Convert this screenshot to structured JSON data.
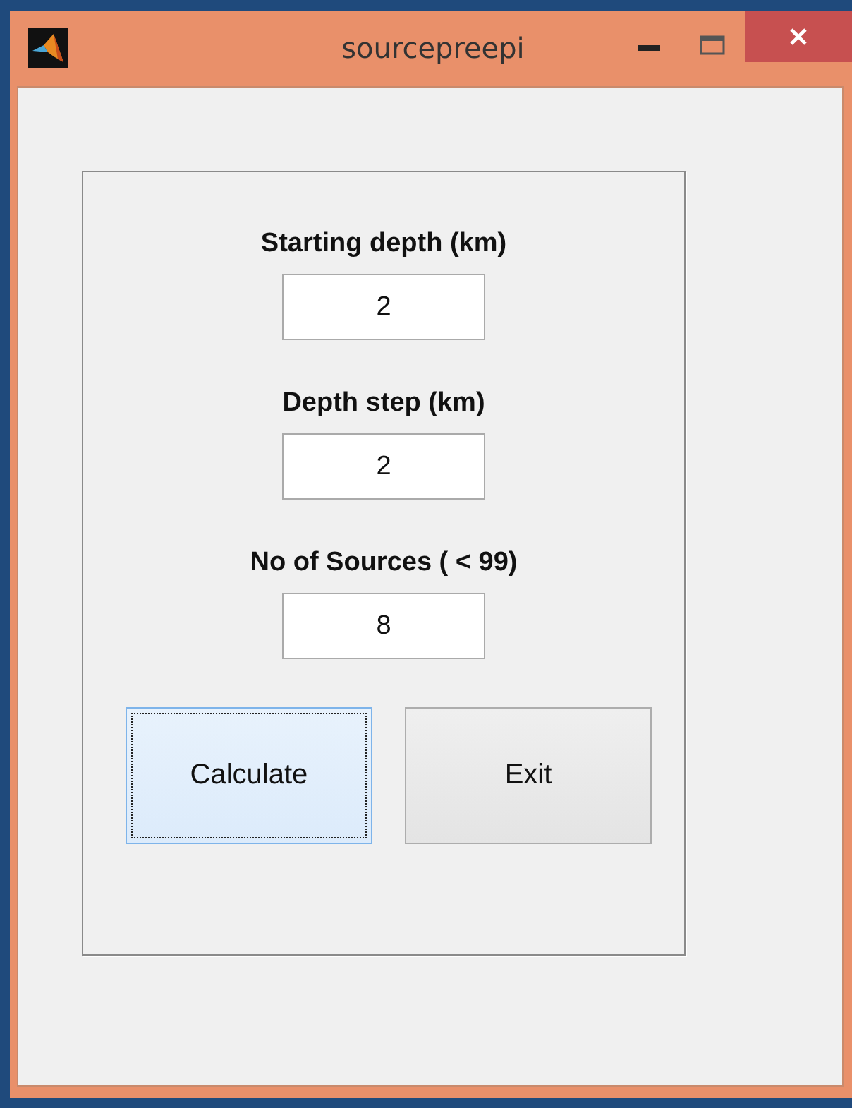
{
  "window": {
    "title": "sourcepreepi"
  },
  "fields": [
    {
      "label": "Starting depth (km)",
      "value": "2"
    },
    {
      "label": "Depth step (km)",
      "value": "2"
    },
    {
      "label": "No of Sources ( < 99)",
      "value": "8"
    }
  ],
  "buttons": [
    {
      "label": "Calculate",
      "focused": true
    },
    {
      "label": "Exit",
      "focused": false
    }
  ]
}
